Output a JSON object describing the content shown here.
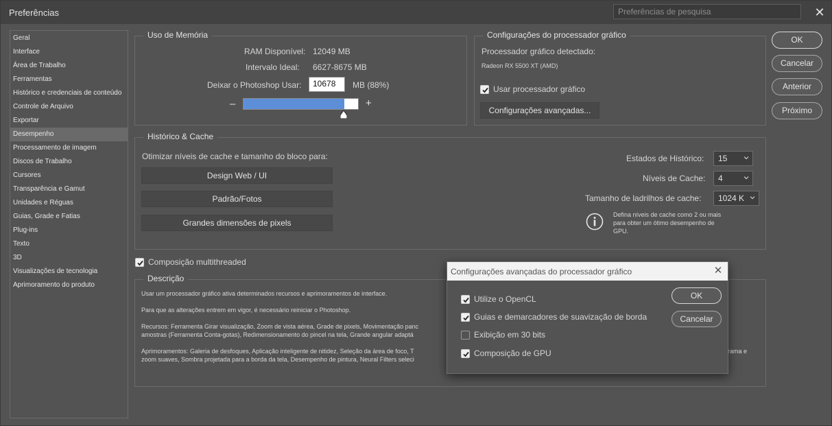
{
  "window": {
    "title": "Preferências",
    "search_placeholder": "Preferências de pesquisa",
    "close_glyph": "✕"
  },
  "sidebar": {
    "items": [
      {
        "label": "Geral"
      },
      {
        "label": "Interface"
      },
      {
        "label": "Área de Trabalho"
      },
      {
        "label": "Ferramentas"
      },
      {
        "label": "Histórico e credenciais de conteúdo"
      },
      {
        "label": "Controle de Arquivo"
      },
      {
        "label": "Exportar"
      },
      {
        "label": "Desempenho",
        "active": true
      },
      {
        "label": "Processamento de imagem"
      },
      {
        "label": "Discos de Trabalho"
      },
      {
        "label": "Cursores"
      },
      {
        "label": "Transparência e Gamut"
      },
      {
        "label": "Unidades e Réguas"
      },
      {
        "label": "Guias, Grade e Fatias"
      },
      {
        "label": "Plug-ins"
      },
      {
        "label": "Texto"
      },
      {
        "label": "3D"
      },
      {
        "label": "Visualizações de tecnologia"
      },
      {
        "label": "Aprimoramento do produto"
      }
    ]
  },
  "memory": {
    "legend": "Uso de Memória",
    "ram_label": "RAM Disponível:",
    "ram_value": "12049 MB",
    "ideal_label": "Intervalo Ideal:",
    "ideal_value": "6627-8675 MB",
    "let_use_label": "Deixar o Photoshop Usar:",
    "let_use_value": "10678",
    "let_use_unit": "MB (88%)",
    "minus": "–",
    "plus": "+",
    "slider_fraction": 0.88
  },
  "gpu": {
    "legend": "Configurações do processador gráfico",
    "detected_label": "Processador gráfico detectado:",
    "detected_value": "Radeon RX 5500 XT (AMD)",
    "use_gpu_label": "Usar processador gráfico",
    "use_gpu_checked": true,
    "advanced_button": "Configurações avançadas..."
  },
  "actions": {
    "ok": "OK",
    "cancel": "Cancelar",
    "previous": "Anterior",
    "next": "Próximo"
  },
  "cache": {
    "legend": "Histórico & Cache",
    "optimize_label": "Otimizar níveis de cache e tamanho do bloco para:",
    "presets": [
      "Design Web / UI",
      "Padrão/Fotos",
      "Grandes dimensões de pixels"
    ],
    "history_states_label": "Estados de Histórico:",
    "history_states_value": "15",
    "cache_levels_label": "Níveis de Cache:",
    "cache_levels_value": "4",
    "tile_size_label": "Tamanho de ladrilhos de cache:",
    "tile_size_value": "1024 K",
    "info_line1": "Defina níveis de cache como 2 ou mais",
    "info_line2": "para obter um ótimo desempenho de",
    "info_line3": "GPU."
  },
  "multithreaded": {
    "label": "Composição multithreaded",
    "checked": true
  },
  "description": {
    "legend": "Descrição",
    "line1": "Usar um processador gráfico ativa determinados recursos e aprimoramentos de interface.",
    "line2": "Para que as alterações entrem em vigor, é necessário reiniciar o Photoshop.",
    "line3a": "Recursos: Ferramenta Girar visualização, Zoom de vista aérea, Grade de pixels, Movimentação panc",
    "line3b": "amostras (Ferramenta Conta-gotas), Redimensionamento do pincel na tela, Grande angular adaptá",
    "line4a": "Aprimoramentos: Galeria de desfoques, Aplicação inteligente de nitidez, Seleção da área de foco, T",
    "line4a_tail": "rama e",
    "line4b": "zoom suaves, Sombra projetada para a borda da tela, Desempenho de pintura, Neural Filters seleci"
  },
  "advanced_dialog": {
    "title": "Configurações avançadas do processador gráfico",
    "close_glyph": "✕",
    "options": [
      {
        "label": "Utilize o OpenCL",
        "checked": true
      },
      {
        "label": "Guias e demarcadores de suavização de borda",
        "checked": true
      },
      {
        "label": "Exibição em 30 bits",
        "checked": false
      },
      {
        "label": "Composição de GPU",
        "checked": true
      }
    ],
    "ok": "OK",
    "cancel": "Cancelar"
  }
}
